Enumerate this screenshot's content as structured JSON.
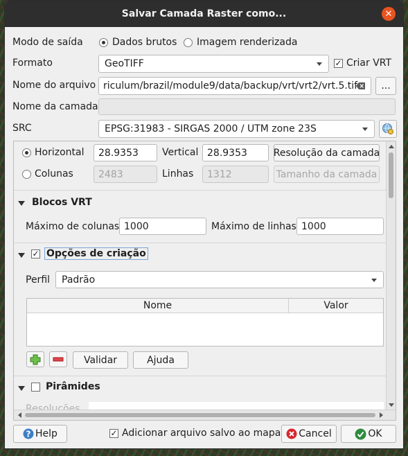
{
  "window": {
    "title": "Salvar Camada Raster como..."
  },
  "output_mode": {
    "label": "Modo de saída",
    "options": [
      "Dados brutos",
      "Imagem renderizada"
    ],
    "selected": "Dados brutos"
  },
  "format": {
    "label": "Formato",
    "value": "GeoTIFF",
    "create_vrt_label": "Criar VRT",
    "create_vrt_checked": true
  },
  "file_name": {
    "label": "Nome do arquivo",
    "value": "riculum/brazil/module9/data/backup/vrt/vrt2/vrt.5.tif",
    "browse_label": "..."
  },
  "layer_name": {
    "label": "Nome da camada",
    "value": ""
  },
  "crs": {
    "label": "SRC",
    "value": "EPSG:31983 - SIRGAS 2000 / UTM zone 23S"
  },
  "resolution": {
    "horizontal_label": "Horizontal",
    "horizontal_value": "28.9353",
    "vertical_label": "Vertical",
    "vertical_value": "28.9353",
    "layer_resolution_button": "Resolução da camada",
    "columns_label": "Colunas",
    "columns_value": "2483",
    "rows_label": "Linhas",
    "rows_value": "1312",
    "layer_size_button": "Tamanho da camada"
  },
  "vrt_blocks": {
    "title": "Blocos VRT",
    "max_columns_label": "Máximo de colunas",
    "max_columns_value": "1000",
    "max_rows_label": "Máximo de linhas",
    "max_rows_value": "1000"
  },
  "creation_options": {
    "title": "Opções de criação",
    "checked": true,
    "profile_label": "Perfil",
    "profile_value": "Padrão",
    "table_headers": [
      "Nome",
      "Valor"
    ],
    "validate_button": "Validar",
    "help_button": "Ajuda"
  },
  "pyramids": {
    "title": "Pirâmides",
    "checked": false,
    "resolutions_label": "Resoluções"
  },
  "footer": {
    "help_button": "Help",
    "add_to_map_label": "Adicionar arquivo salvo ao mapa",
    "add_to_map_checked": true,
    "cancel_button": "Cancel",
    "ok_button": "OK"
  }
}
